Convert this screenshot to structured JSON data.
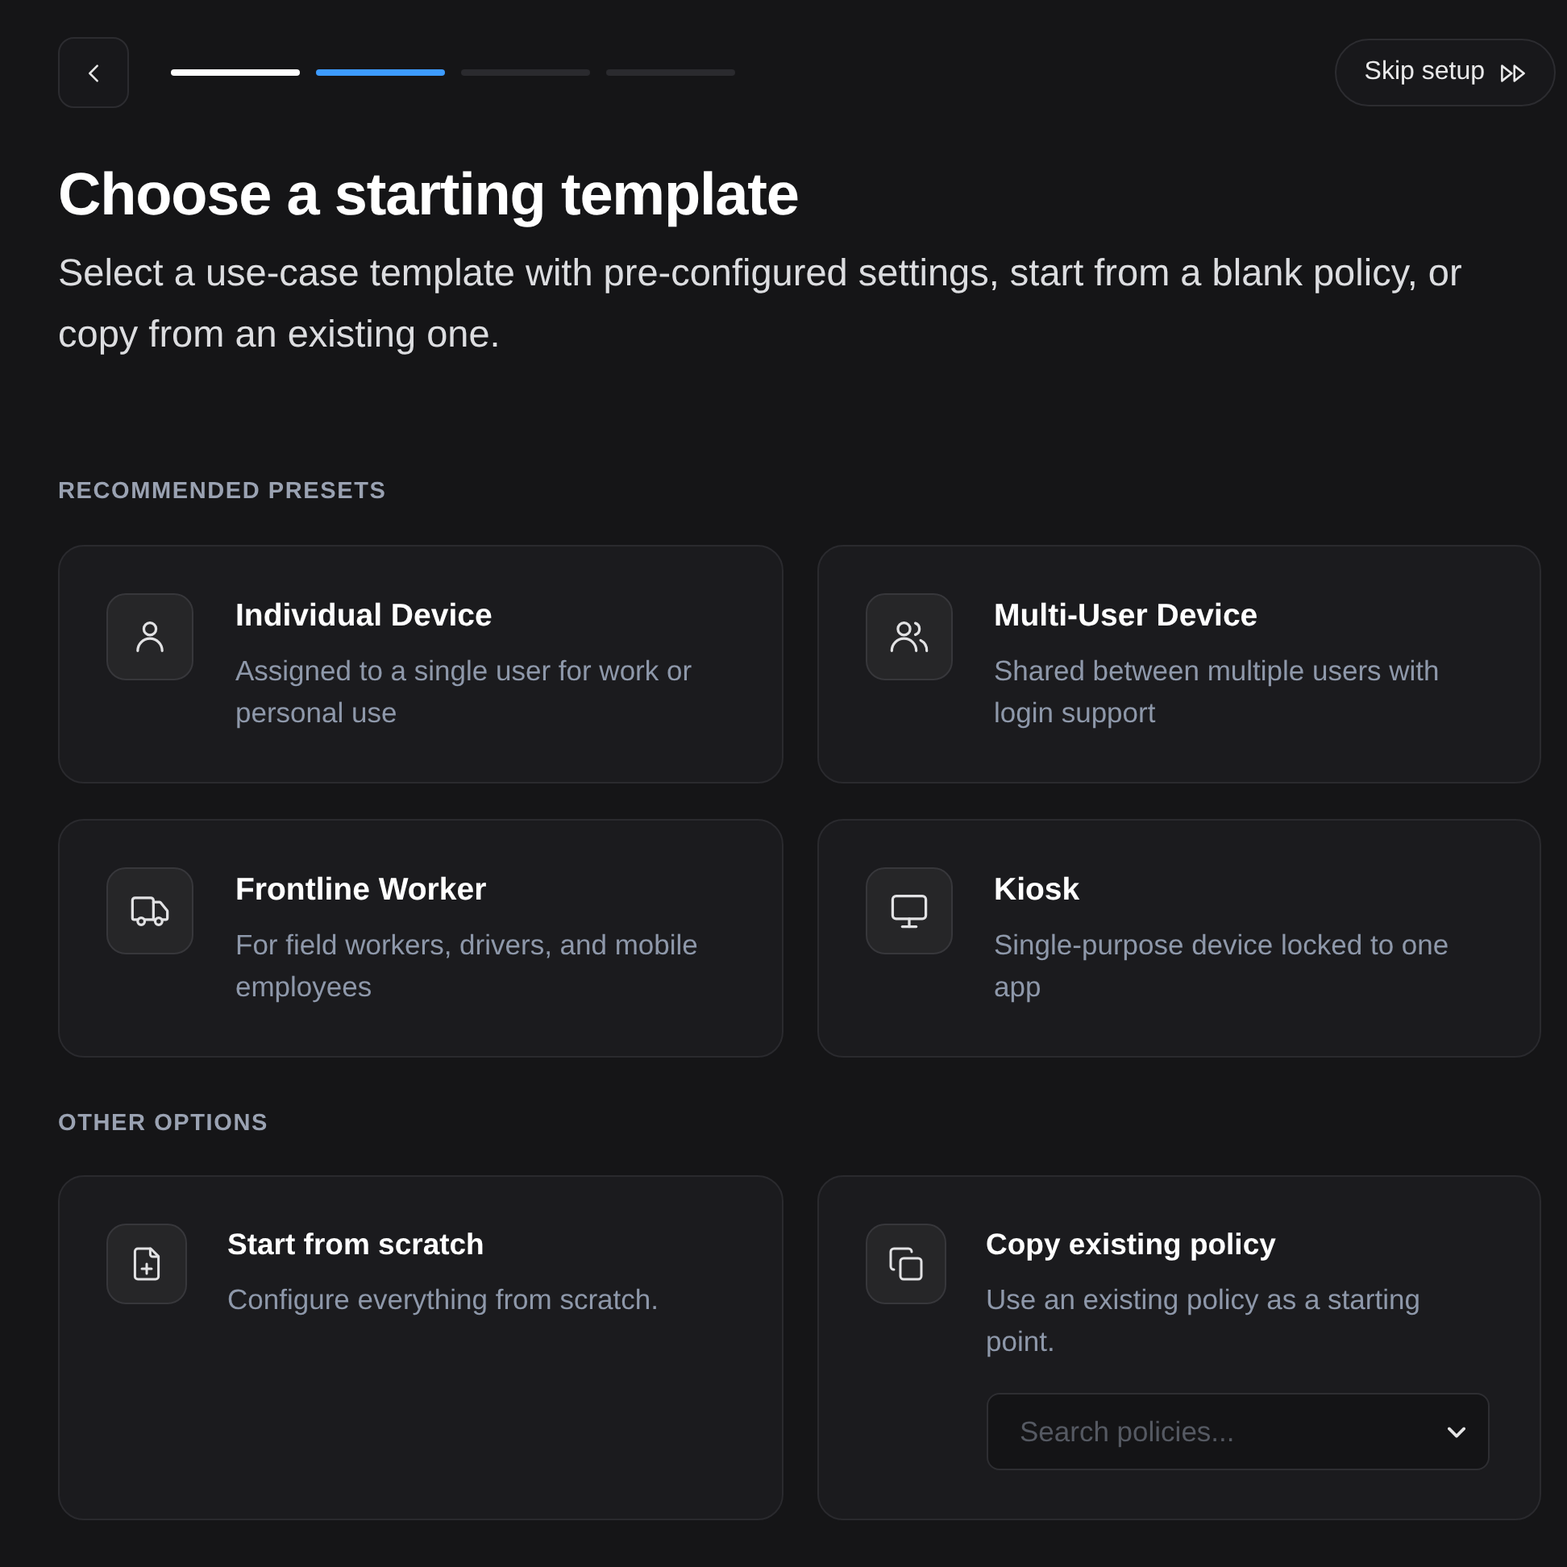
{
  "progress_steps": [
    {
      "completed": true,
      "selected": false
    },
    {
      "completed": false,
      "selected": true
    },
    {
      "completed": false,
      "selected": false
    },
    {
      "completed": false,
      "selected": false
    }
  ],
  "skip_button": {
    "label": "Skip setup"
  },
  "title": "Choose a starting template",
  "subtitle": "Select a use-case template with pre-configured settings, start from a blank policy, or copy from an existing one.",
  "recommended_presets": {
    "heading": "RECOMMENDED PRESETS",
    "cards": [
      {
        "title": "Individual Device",
        "description": "Assigned to a single user for work or personal use"
      },
      {
        "title": "Multi-User Device",
        "description": "Shared between multiple users with login support"
      },
      {
        "title": "Frontline Worker",
        "description": "For field workers, drivers, and mobile employees"
      },
      {
        "title": "Kiosk",
        "description": "Single-purpose device locked to one app"
      }
    ]
  },
  "other_options": {
    "heading": "OTHER OPTIONS",
    "cards": [
      {
        "title": "Start from scratch",
        "description": "Configure everything from scratch."
      },
      {
        "title": "Copy existing policy",
        "description": "Use an existing policy as a starting point.",
        "search_field": {
          "placeholder": "Search policies..."
        }
      }
    ]
  }
}
